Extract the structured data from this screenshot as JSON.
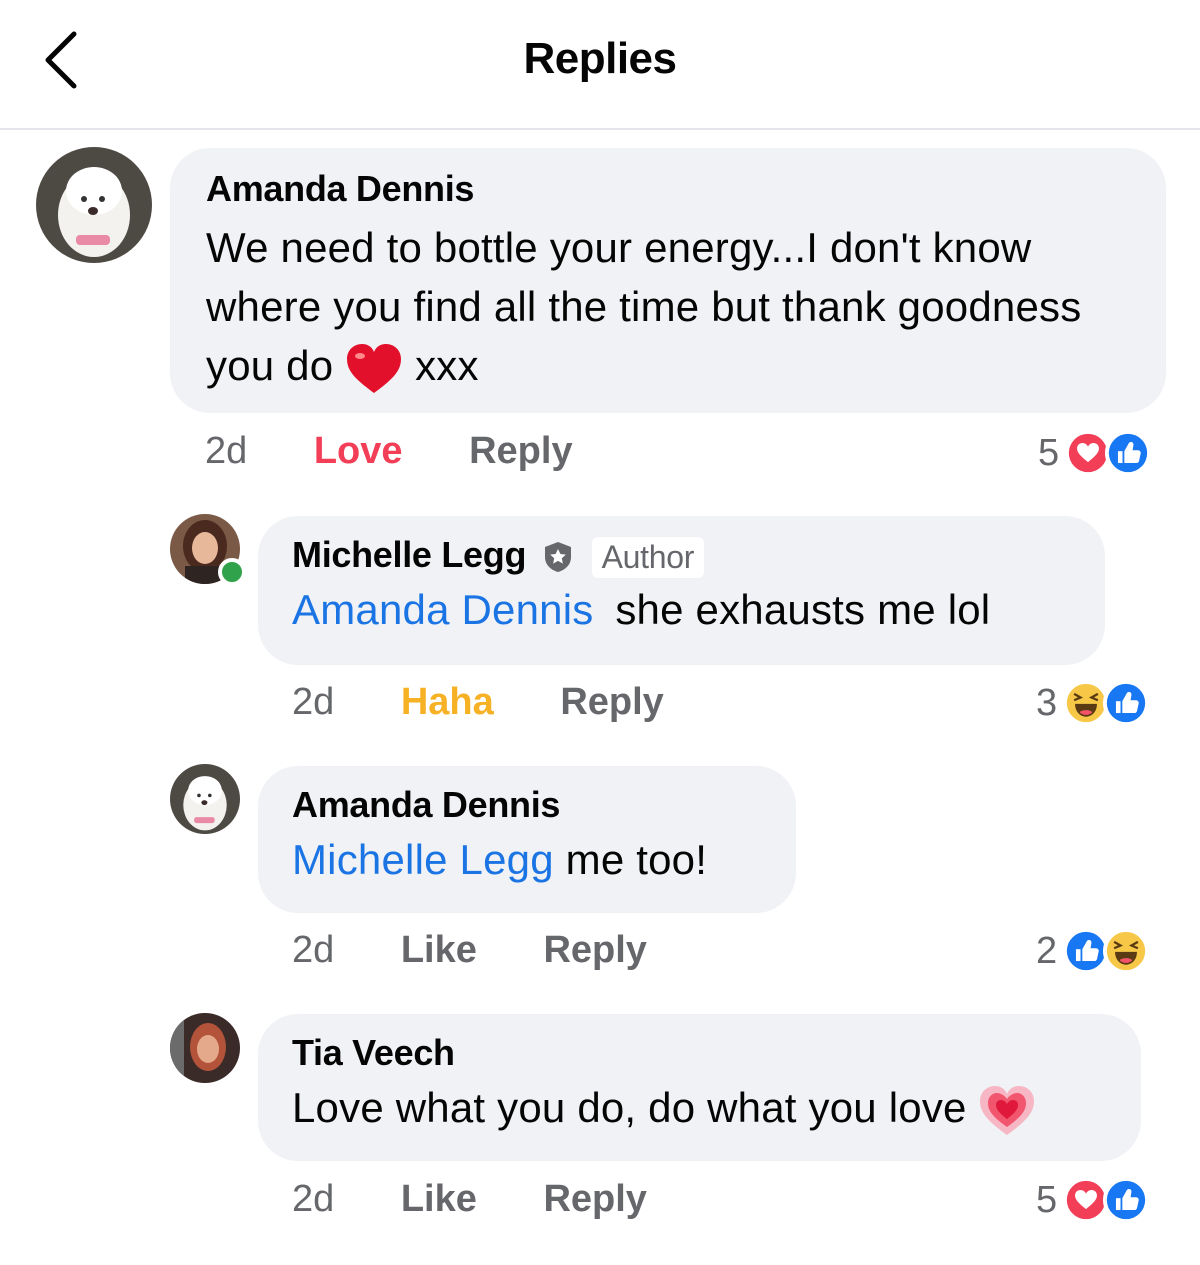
{
  "header": {
    "title": "Replies",
    "back_icon": "chevron-left-icon"
  },
  "comments": [
    {
      "author": "Amanda Dennis",
      "text": "We need to bottle your energy...I don't know where you find all the time but thank goodness you do",
      "text_after_emoji": "xxx",
      "emoji": "red-heart",
      "time": "2d",
      "reaction_label": "Love",
      "reaction_color": "#f33e58",
      "reply_label": "Reply",
      "reaction_count": "5",
      "reaction_icons": [
        "love-icon",
        "like-icon"
      ]
    },
    {
      "author": "Michelle Legg",
      "badge": "Author",
      "online": true,
      "mention": "Amanda Dennis",
      "text": "she exhausts me lol",
      "time": "2d",
      "reaction_label": "Haha",
      "reaction_color": "#f7b125",
      "reply_label": "Reply",
      "reaction_count": "3",
      "reaction_icons": [
        "haha-icon",
        "like-icon"
      ]
    },
    {
      "author": "Amanda Dennis",
      "mention": "Michelle Legg",
      "text": "me too!",
      "time": "2d",
      "reaction_label": "Like",
      "reply_label": "Reply",
      "reaction_count": "2",
      "reaction_icons": [
        "like-icon",
        "haha-icon"
      ]
    },
    {
      "author": "Tia Veech",
      "text": "Love what you do, do what you love",
      "emoji": "growing-heart",
      "time": "2d",
      "reaction_label": "Like",
      "reply_label": "Reply",
      "reaction_count": "5",
      "reaction_icons": [
        "love-icon",
        "like-icon"
      ]
    }
  ],
  "colors": {
    "mention": "#1b74e4",
    "bubble": "#f0f2f5",
    "meta": "#65676b",
    "online": "#31a24c"
  }
}
